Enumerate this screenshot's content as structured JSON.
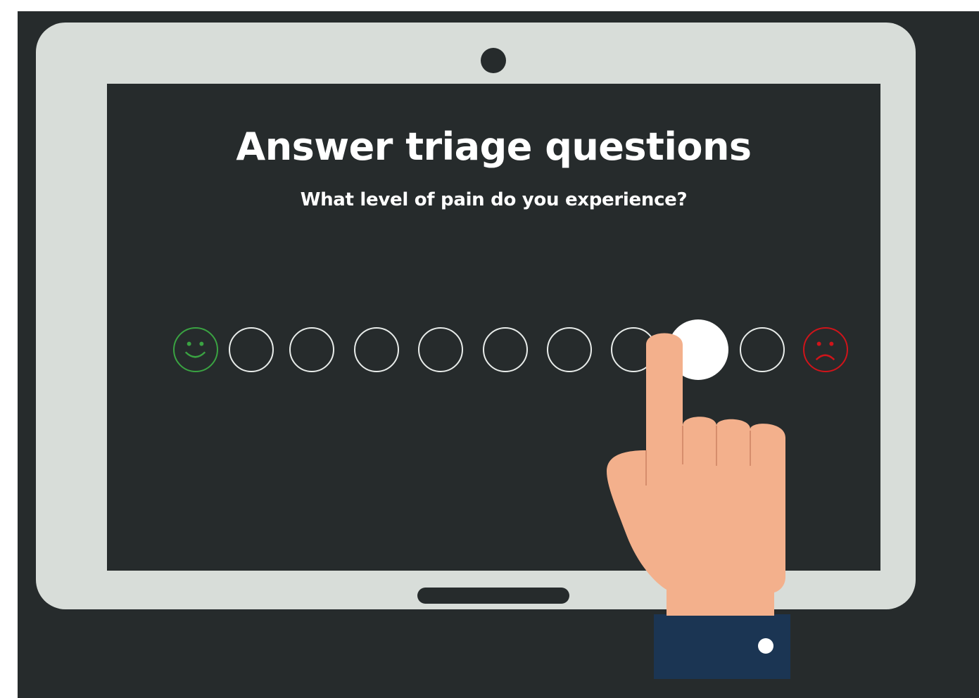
{
  "screen": {
    "title": "Answer triage questions",
    "question": "What level of pain do you experience?"
  },
  "pain_scale": {
    "levels": 11,
    "selected_index": 8,
    "start_icon": "smiley-face-icon",
    "end_icon": "frowning-face-icon",
    "colors": {
      "start": "#3aa342",
      "end": "#d0141a",
      "option_outline": "#e8ecea",
      "selected_fill": "#ffffff"
    }
  },
  "illustration": {
    "pointer_icon": "pointing-hand-icon",
    "colors": {
      "skin": "#f3b08c",
      "sleeve": "#1b3553",
      "device_frame": "#d8ddd9",
      "background": "#262b2c"
    }
  }
}
